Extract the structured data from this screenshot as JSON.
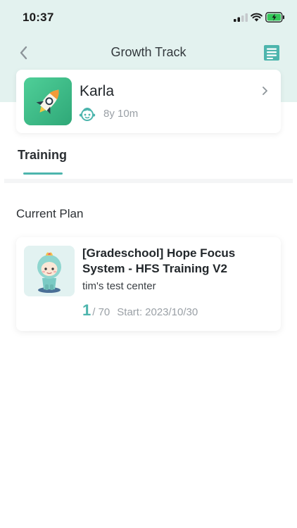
{
  "status_bar": {
    "time": "10:37"
  },
  "navbar": {
    "title": "Growth Track",
    "icons": {
      "back": "chevron-left-icon",
      "right": "document-list-icon"
    }
  },
  "profile": {
    "name": "Karla",
    "age": "8y 10m",
    "icons": {
      "avatar": "rocket-icon",
      "age": "kid-face-icon",
      "more": "chevron-right-icon"
    }
  },
  "tabs": [
    {
      "label": "Training",
      "active": true
    }
  ],
  "current_plan": {
    "section_title": "Current Plan",
    "title": "[Gradeschool] Hope Focus System - HFS Training V2",
    "center": "tim's test center",
    "progress_current": "1",
    "progress_total": "/ 70",
    "start_label": "Start:",
    "start_date": "2023/10/30"
  },
  "colors": {
    "header_bg": "#e3f2ef",
    "accent": "#4db5ad",
    "avatar_bg": "#3dc08a"
  }
}
